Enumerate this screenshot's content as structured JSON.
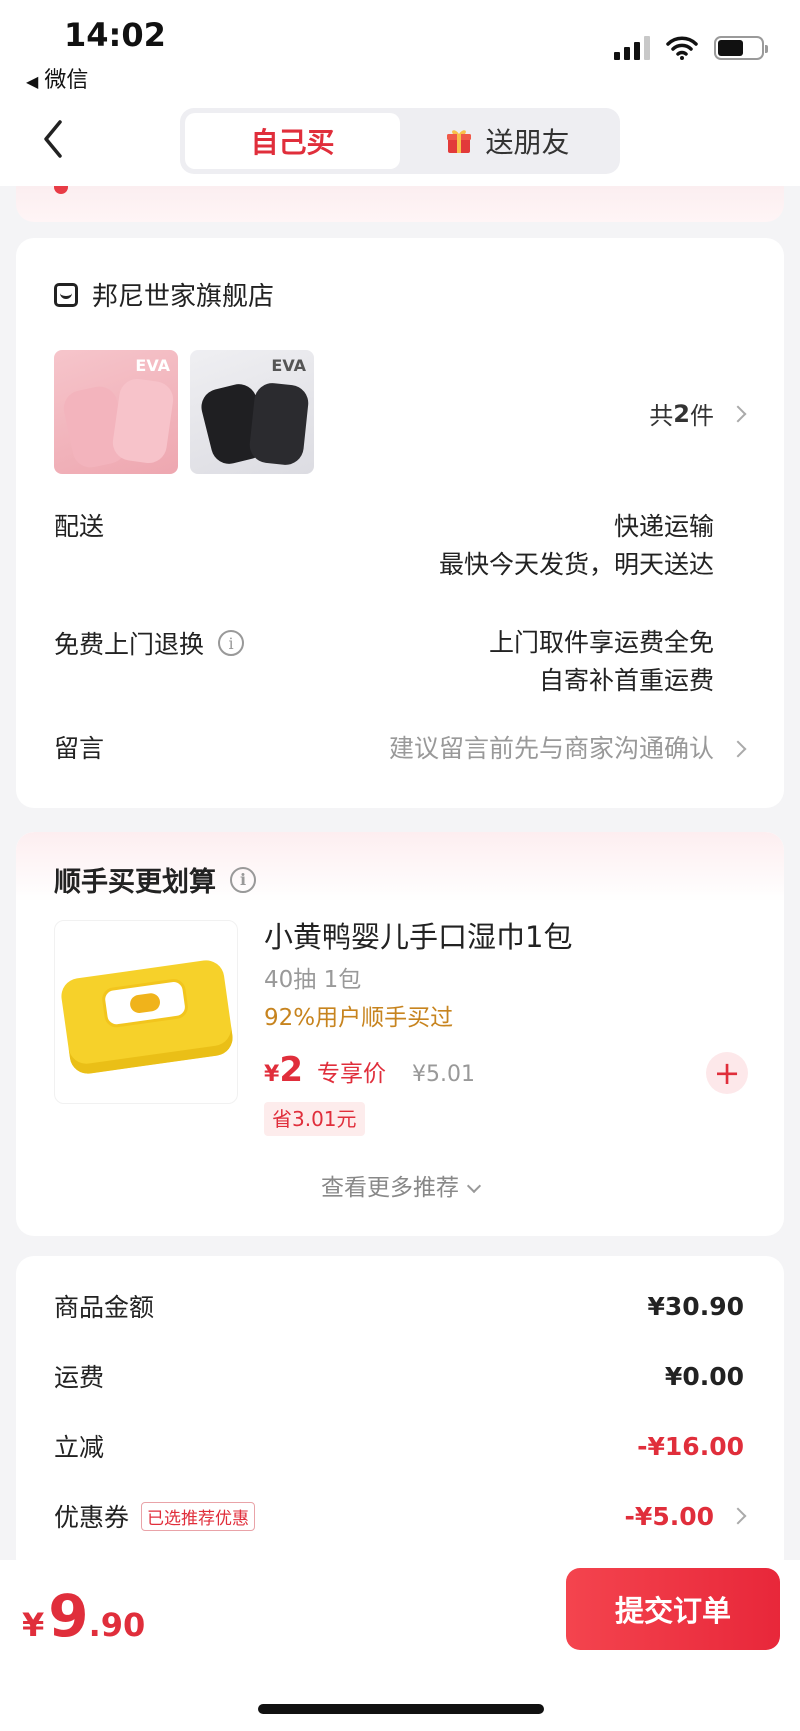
{
  "status": {
    "time": "14:02",
    "back_app": "微信"
  },
  "tabs": [
    {
      "label": "自己买",
      "active": true
    },
    {
      "label": "送朋友",
      "active": false
    }
  ],
  "shop": {
    "name": "邦尼世家旗舰店",
    "thumbs": [
      {
        "badge": "EVA",
        "color": "pink"
      },
      {
        "badge": "EVA",
        "color": "black"
      }
    ],
    "count_prefix": "共",
    "count": "2",
    "count_suffix": "件",
    "delivery_label": "配送",
    "delivery_line1": "快递运输",
    "delivery_line2": "最快今天发货，明天送达",
    "return_label": "免费上门退换",
    "return_line1": "上门取件享运费全免",
    "return_line2": "自寄补首重运费",
    "message_label": "留言",
    "message_hint": "建议留言前先与商家沟通确认"
  },
  "recommend": {
    "title": "顺手买更划算",
    "name": "小黄鸭婴儿手口湿巾1包",
    "spec": "40抽 1包",
    "popularity": "92%用户顺手买过",
    "currency": "¥",
    "price": "2",
    "price_tag": "专享价",
    "old_price": "¥5.01",
    "save": "省3.01元",
    "more": "查看更多推荐"
  },
  "summary": {
    "rows": [
      {
        "label": "商品金额",
        "value": "¥30.90"
      },
      {
        "label": "运费",
        "value": "¥0.00"
      },
      {
        "label": "立减",
        "value": "-¥16.00"
      },
      {
        "label": "优惠券",
        "badge": "已选推荐优惠",
        "value": "-¥5.00"
      }
    ]
  },
  "bottom": {
    "currency": "¥",
    "total_int": "9",
    "total_dec": ".90",
    "submit": "提交订单"
  },
  "colors": {
    "accent": "#e02e3b",
    "popularity": "#c7841f"
  }
}
